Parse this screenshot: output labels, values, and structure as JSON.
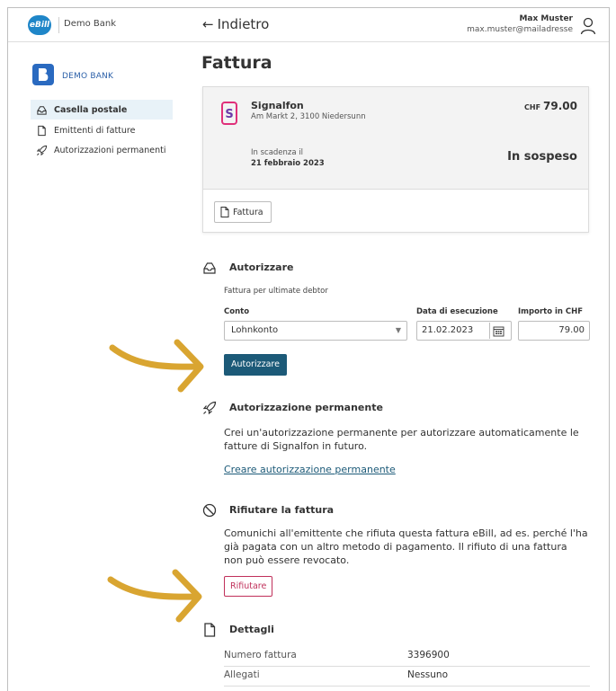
{
  "header": {
    "ebill_logo": "eBill",
    "bank_name": "Demo Bank",
    "back_label": "Indietro",
    "back_icon": "arrow-left-icon",
    "user_name": "Max Muster",
    "user_email": "max.muster@mailadresse",
    "user_icon": "user-icon"
  },
  "sidebar": {
    "logo_text": "DEMO BANK",
    "items": [
      {
        "label": "Casella postale",
        "icon": "inbox-icon",
        "active": true
      },
      {
        "label": "Emittenti di fatture",
        "icon": "document-icon",
        "active": false
      },
      {
        "label": "Autorizzazioni permanenti",
        "icon": "rocket-icon",
        "active": false
      }
    ]
  },
  "page": {
    "title": "Fattura"
  },
  "invoice": {
    "biller": "Signalfon",
    "address": "Am Markt 2, 3100 Niedersunn",
    "currency": "CHF",
    "amount": "79.00",
    "due_label": "In scadenza il",
    "due_date": "21 febbraio 2023",
    "status": "In sospeso",
    "document_button": "Fattura"
  },
  "authorize": {
    "title": "Autorizzare",
    "subtitle": "Fattura per ultimate debtor",
    "account_label": "Conto",
    "account_value": "Lohnkonto",
    "date_label": "Data di esecuzione",
    "date_value": "21.02.2023",
    "amount_label": "Importo in CHF",
    "amount_value": "79.00",
    "button": "Autorizzare"
  },
  "permanent": {
    "title": "Autorizzazione permanente",
    "text": "Crei un'autorizzazione permanente per autorizzare automaticamente le fatture di Signalfon in futuro.",
    "link": "Creare autorizzazione permanente"
  },
  "reject": {
    "title": "Rifiutare la fattura",
    "text": "Comunichi all'emittente che rifiuta questa fattura eBill, ad es. perché l'ha già pagata con un altro metodo di pagamento. Il rifiuto di una fattura non può essere revocato.",
    "button": "Rifiutare"
  },
  "details": {
    "title": "Dettagli",
    "rows": [
      {
        "key": "Numero fattura",
        "value": "3396900"
      },
      {
        "key": "Allegati",
        "value": "Nessuno"
      }
    ]
  },
  "colors": {
    "primary": "#1c5a78",
    "reject": "#c0305a",
    "annotation_arrow": "#d9a531",
    "ebill_blue": "#1f86c8"
  }
}
